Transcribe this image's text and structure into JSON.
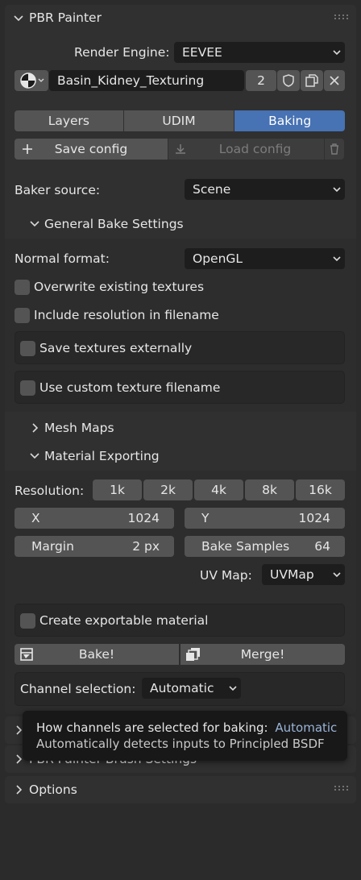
{
  "panel": {
    "title": "PBR Painter"
  },
  "render_engine": {
    "label": "Render Engine:",
    "value": "EEVEE"
  },
  "datablock": {
    "name": "Basin_Kidney_Texturing",
    "users": "2"
  },
  "tabs": [
    {
      "label": "Layers",
      "active": false
    },
    {
      "label": "UDIM",
      "active": false
    },
    {
      "label": "Baking",
      "active": true
    }
  ],
  "config": {
    "save_label": "Save config",
    "load_label": "Load config"
  },
  "baker_source": {
    "label": "Baker source:",
    "value": "Scene"
  },
  "general_bake": {
    "title": "General Bake Settings"
  },
  "normal_format": {
    "label": "Normal format:",
    "value": "OpenGL"
  },
  "options_checks": {
    "overwrite": {
      "label": "Overwrite existing textures",
      "checked": false
    },
    "include_resolution": {
      "label": "Include resolution in filename",
      "checked": false
    },
    "save_external": {
      "label": "Save textures externally",
      "checked": false
    },
    "custom_filename": {
      "label": "Use custom texture filename",
      "checked": false
    }
  },
  "mesh_maps": {
    "title": "Mesh Maps"
  },
  "material_exporting": {
    "title": "Material Exporting"
  },
  "resolution": {
    "label": "Resolution:",
    "presets": [
      "1k",
      "2k",
      "4k",
      "8k",
      "16k"
    ]
  },
  "size": {
    "x_label": "X",
    "x_value": "1024",
    "y_label": "Y",
    "y_value": "1024"
  },
  "margin": {
    "label": "Margin",
    "value": "2 px"
  },
  "bake_samples": {
    "label": "Bake Samples",
    "value": "64"
  },
  "uv_map": {
    "label": "UV Map:",
    "value": "UVMap"
  },
  "create_material": {
    "label": "Create exportable material",
    "checked": false
  },
  "actions": {
    "bake_label": "Bake!",
    "merge_label": "Merge!"
  },
  "channel_selection": {
    "label": "Channel selection:",
    "value": "Automatic"
  },
  "tooltip": {
    "line1": "How channels are selected for baking:",
    "value": "Automatic",
    "line2": "Automatically detects inputs to Principled BSDF"
  },
  "brush_settings": {
    "title": "PBR Painter Brush Settings"
  },
  "options_panel": {
    "title": "Options"
  },
  "colors": {
    "accent": "#4772b3",
    "bg": "#2b2b2b",
    "panel": "#303030",
    "button": "#545454",
    "field": "#1d1d1d"
  }
}
